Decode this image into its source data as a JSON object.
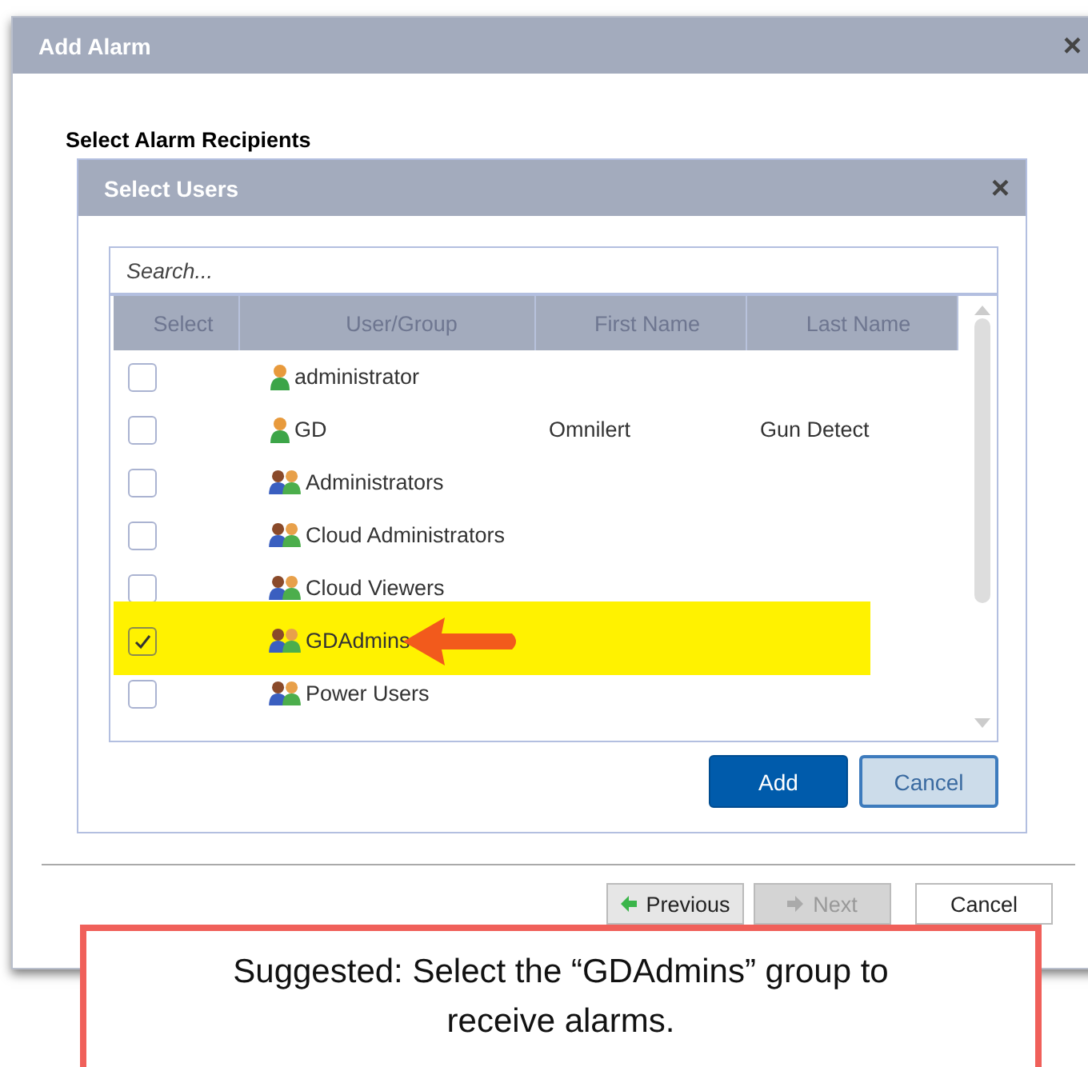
{
  "window": {
    "title": "Add Alarm",
    "close": "×"
  },
  "section_title": "Select Alarm Recipients",
  "dialog": {
    "title": "Select Users",
    "close": "×"
  },
  "search": {
    "placeholder": "Search..."
  },
  "table": {
    "columns": [
      "Select",
      "User/Group",
      "First Name",
      "Last Name"
    ],
    "rows": [
      {
        "kind": "user",
        "name": "administrator",
        "first_name": "",
        "last_name": "",
        "checked": false,
        "highlighted": false
      },
      {
        "kind": "user",
        "name": "GD",
        "first_name": "Omnilert",
        "last_name": "Gun Detect",
        "checked": false,
        "highlighted": false
      },
      {
        "kind": "group",
        "name": "Administrators",
        "first_name": "",
        "last_name": "",
        "checked": false,
        "highlighted": false
      },
      {
        "kind": "group",
        "name": "Cloud Administrators",
        "first_name": "",
        "last_name": "",
        "checked": false,
        "highlighted": false
      },
      {
        "kind": "group",
        "name": "Cloud Viewers",
        "first_name": "",
        "last_name": "",
        "checked": false,
        "highlighted": false
      },
      {
        "kind": "group",
        "name": "GDAdmins",
        "first_name": "",
        "last_name": "",
        "checked": true,
        "highlighted": true
      },
      {
        "kind": "group",
        "name": "Power Users",
        "first_name": "",
        "last_name": "",
        "checked": false,
        "highlighted": false
      }
    ]
  },
  "dialog_buttons": [
    {
      "label": "Add",
      "kind": "primary"
    },
    {
      "label": "Cancel",
      "kind": "secondary"
    }
  ],
  "footer_buttons": [
    {
      "label": "Previous",
      "kind": "back",
      "disabled": false
    },
    {
      "label": "Next",
      "kind": "forward",
      "disabled": true
    },
    {
      "label": "Cancel",
      "kind": "plain",
      "disabled": false
    }
  ],
  "callout": "Suggested: Select the “GDAdmins” group to receive alarms."
}
